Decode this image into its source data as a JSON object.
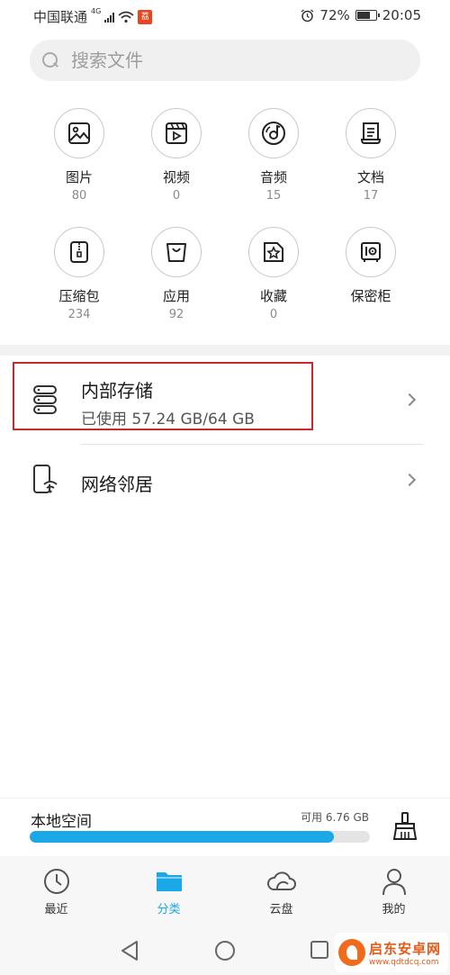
{
  "status_bar": {
    "carrier": "中国联通",
    "network_tag": "4G",
    "app_badge": "荔",
    "battery_percent": "72%",
    "battery_level": 0.72,
    "time": "20:05",
    "icons": [
      "signal-icon",
      "wifi-icon",
      "app-notification-icon",
      "alarm-icon",
      "battery-icon"
    ]
  },
  "search": {
    "placeholder": "搜索文件"
  },
  "categories": [
    {
      "label": "图片",
      "count": "80",
      "icon": "image-icon"
    },
    {
      "label": "视频",
      "count": "0",
      "icon": "video-icon"
    },
    {
      "label": "音频",
      "count": "15",
      "icon": "audio-icon"
    },
    {
      "label": "文档",
      "count": "17",
      "icon": "document-icon"
    },
    {
      "label": "压缩包",
      "count": "234",
      "icon": "archive-icon"
    },
    {
      "label": "应用",
      "count": "92",
      "icon": "app-bag-icon"
    },
    {
      "label": "收藏",
      "count": "0",
      "icon": "favorite-star-icon"
    },
    {
      "label": "保密柜",
      "count": "",
      "icon": "safe-icon"
    }
  ],
  "storage": {
    "internal_title": "内部存储",
    "internal_usage": "已使用 57.24 GB/64 GB",
    "network_title": "网络邻居"
  },
  "local_space": {
    "title": "本地空间",
    "available": "可用 6.76 GB",
    "used_fraction": 0.894
  },
  "tabs": [
    {
      "label": "最近",
      "icon": "clock-icon",
      "active": false
    },
    {
      "label": "分类",
      "icon": "folder-icon",
      "active": true
    },
    {
      "label": "云盘",
      "icon": "cloud-icon",
      "active": false
    },
    {
      "label": "我的",
      "icon": "person-icon",
      "active": false
    }
  ],
  "watermark": {
    "name": "启东安卓网",
    "url": "www.qdtdcq.com"
  },
  "colors": {
    "accent": "#1aa8e6",
    "highlight_border": "#c8282e",
    "watermark": "#e35b17"
  }
}
